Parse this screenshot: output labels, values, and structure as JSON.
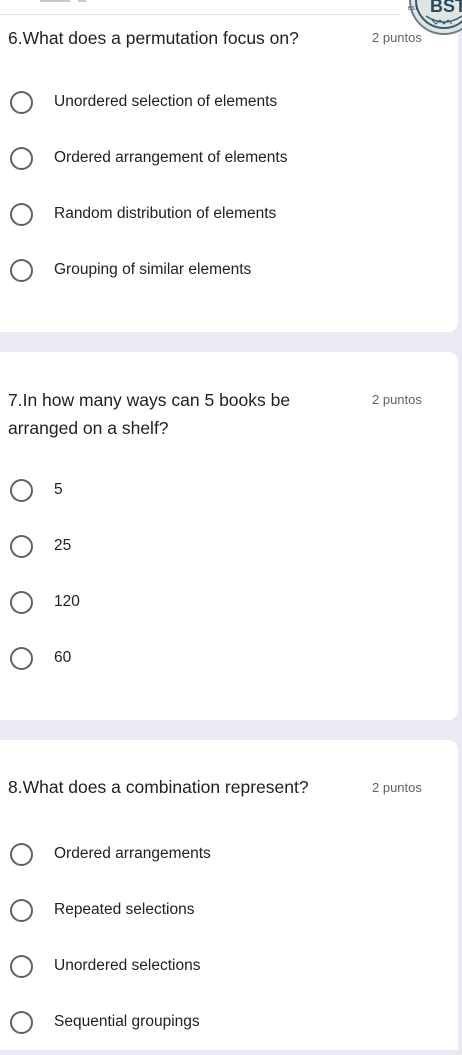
{
  "logo": {
    "text": "BSTI",
    "small_text": "BST"
  },
  "questions": [
    {
      "title": "6.What does a permutation focus on?",
      "points": "2 puntos",
      "options": [
        "Unordered selection of elements",
        "Ordered arrangement of elements",
        "Random distribution of elements",
        "Grouping of similar elements"
      ]
    },
    {
      "title": "7.In how many ways can 5 books be arranged on a shelf?",
      "points": "2 puntos",
      "options": [
        "5",
        "25",
        "120",
        "60"
      ]
    },
    {
      "title": "8.What does a combination represent?",
      "points": "2 puntos",
      "options": [
        "Ordered arrangements",
        "Repeated selections",
        "Unordered selections",
        "Sequential groupings"
      ]
    }
  ]
}
